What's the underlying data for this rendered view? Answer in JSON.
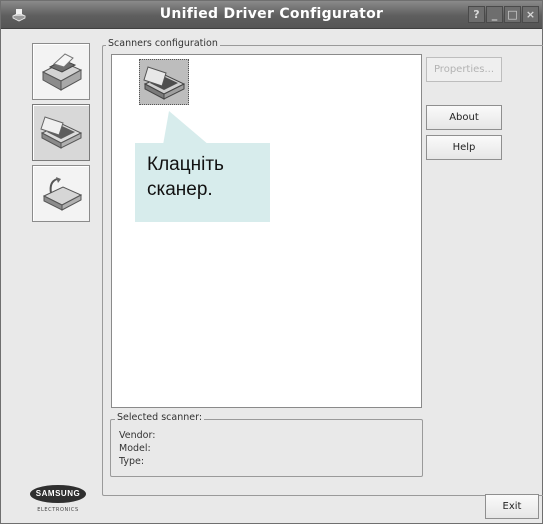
{
  "window": {
    "title": "Unified Driver Configurator",
    "title_buttons": [
      "?",
      "_",
      "□",
      "×"
    ]
  },
  "sidebar": {
    "items": [
      {
        "name": "printers",
        "icon": "printer-icon"
      },
      {
        "name": "scanners",
        "icon": "scanner-icon",
        "active": true
      },
      {
        "name": "ports",
        "icon": "port-icon"
      }
    ]
  },
  "scanners_group": {
    "label": "Scanners configuration",
    "list": [
      {
        "icon": "scanner-icon",
        "selected": true
      }
    ]
  },
  "buttons": {
    "properties": "Properties...",
    "about": "About",
    "help": "Help",
    "exit": "Exit"
  },
  "callout": {
    "line1": "Клацніть",
    "line2": "сканер."
  },
  "selected_scanner": {
    "label": "Selected scanner:",
    "vendor": "Vendor:",
    "model": "Model:",
    "type": "Type:"
  },
  "logo": {
    "brand": "SAMSUNG",
    "sub": "ELECTRONICS"
  },
  "colors": {
    "titlebar": "#5e5e5e",
    "window_bg": "#e9e9e9",
    "callout_bg": "#d7ecec"
  }
}
